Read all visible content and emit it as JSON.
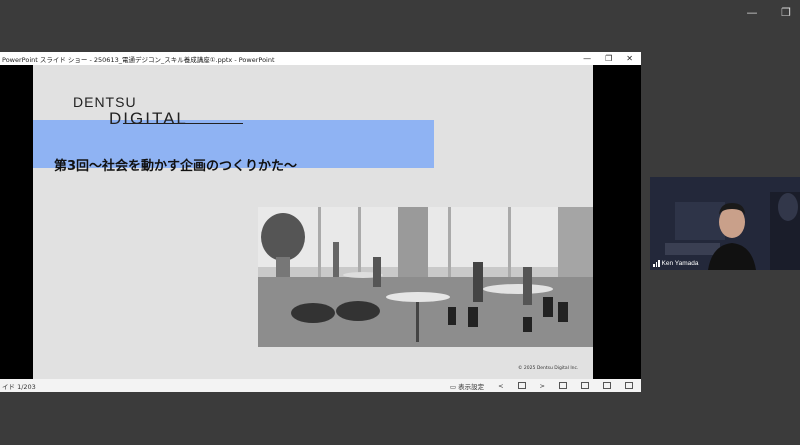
{
  "outer_window": {
    "minimize_icon": "—",
    "restore_icon": "❐"
  },
  "powerpoint": {
    "title": "PowerPoint スライド ショー - 250613_電通デジコン_スキル養成講座①.pptx - PowerPoint",
    "controls": {
      "minimize": "—",
      "restore": "❐",
      "close": "✕"
    },
    "status": {
      "slide_count": "イド 1/203",
      "display_settings": "表示設定",
      "prev": "<",
      "next": ">"
    }
  },
  "slide": {
    "logo_line1": "DENTSU",
    "logo_line2": "DIGITAL",
    "headline": "第3回～社会を動かす企画のつくりかた～",
    "copyright": "© 2025 Dentsu Digital Inc.",
    "accent_color": "#8fb3f3"
  },
  "participant": {
    "name": "Ken Yamada"
  }
}
